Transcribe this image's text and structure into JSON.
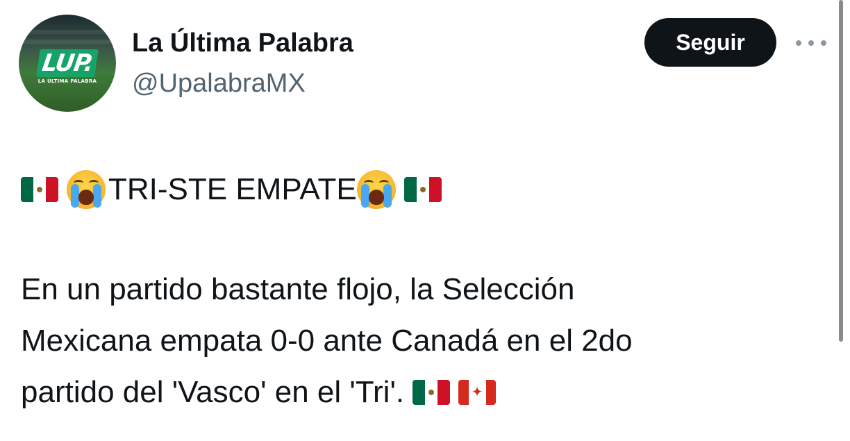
{
  "account": {
    "display_name": "La Última Palabra",
    "handle": "@UpalabraMX",
    "avatar": {
      "logo_text": "LUP.",
      "logo_subtitle": "LA ÚLTIMA PALABRA",
      "brand_color": "#16a36a"
    }
  },
  "actions": {
    "follow_label": "Seguir",
    "more_icon": "more-horizontal-icon"
  },
  "tweet": {
    "headline_text": "TRI-STE EMPATE",
    "body_line_1": "En un partido bastante flojo, la Selección",
    "body_line_2": "Mexicana empata 0-0 ante Canadá en el 2do",
    "body_line_3": "partido del 'Vasco' en el 'Tri'.",
    "emojis": {
      "headline": [
        "mexico-flag",
        "loudly-crying-face",
        "loudly-crying-face",
        "mexico-flag"
      ],
      "body_end": [
        "mexico-flag",
        "canada-flag"
      ]
    }
  },
  "colors": {
    "text": "#0f1419",
    "secondary_text": "#536471",
    "button_bg": "#0f1419",
    "button_text": "#ffffff"
  }
}
